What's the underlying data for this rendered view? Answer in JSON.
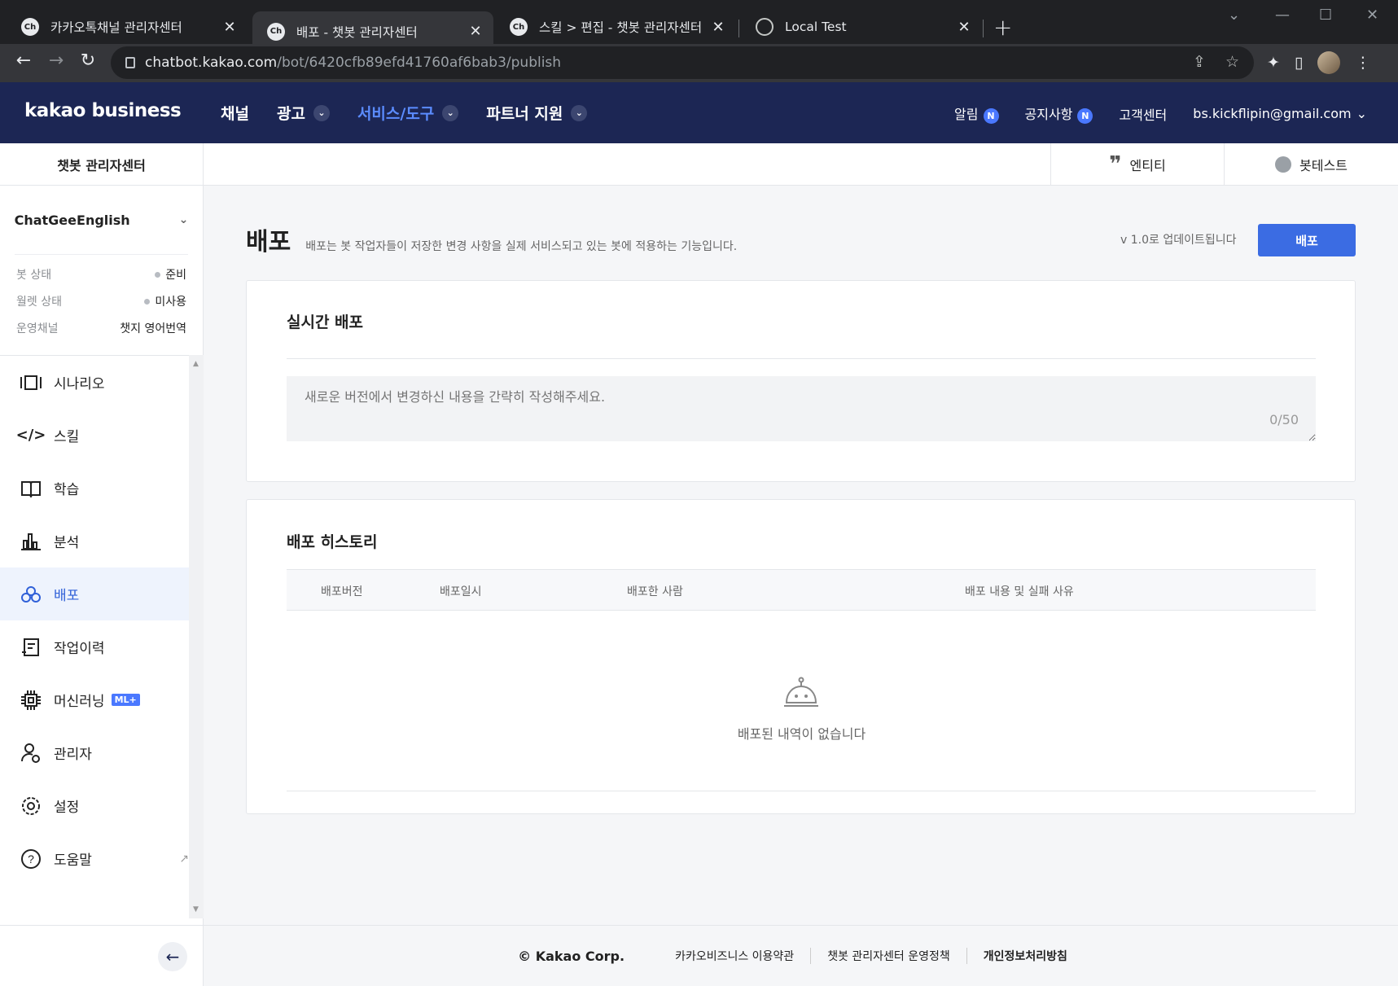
{
  "browser": {
    "tabs": [
      {
        "favicon": "Ch",
        "label": "카카오톡채널 관리자센터"
      },
      {
        "favicon": "Ch",
        "label": "배포 - 챗봇 관리자센터"
      },
      {
        "favicon": "Ch",
        "label": "스킬 > 편집 - 챗봇 관리자센터"
      },
      {
        "favicon": "globe-icon",
        "label": "Local Test"
      }
    ],
    "url_host": "chatbot.kakao.com",
    "url_path": "/bot/6420cfb89efd41760af6bab3/publish"
  },
  "header": {
    "logo": "kakao business",
    "nav": [
      {
        "label": "채널"
      },
      {
        "label": "광고"
      },
      {
        "label": "서비스/도구"
      },
      {
        "label": "파트너 지원"
      }
    ],
    "right": {
      "alert": "알림",
      "notice": "공지사항",
      "badge": "N",
      "support": "고객센터",
      "account": "bs.kickflipin@gmail.com"
    }
  },
  "sidebar": {
    "title": "챗봇 관리자센터",
    "bot_name": "ChatGeeEnglish",
    "info": [
      {
        "key": "봇 상태",
        "value": "준비"
      },
      {
        "key": "월렛 상태",
        "value": "미사용"
      },
      {
        "key": "운영채널",
        "value": "챗지 영어번역"
      }
    ],
    "menu": [
      {
        "label": "시나리오"
      },
      {
        "label": "스킬"
      },
      {
        "label": "학습"
      },
      {
        "label": "분석"
      },
      {
        "label": "배포"
      },
      {
        "label": "작업이력"
      },
      {
        "label": "머신러닝",
        "badge": "ML+"
      },
      {
        "label": "관리자"
      },
      {
        "label": "설정"
      },
      {
        "label": "도움말"
      }
    ]
  },
  "subbar": {
    "entity": "엔티티",
    "bottest": "봇테스트"
  },
  "page": {
    "title": "배포",
    "description": "배포는 봇 작업자들이 저장한 변경 사항을 실제 서비스되고 있는 봇에 적용하는 기능입니다.",
    "version_note": "v 1.0로 업데이트됩니다",
    "deploy_button": "배포",
    "live_title": "실시간 배포",
    "textarea_placeholder": "새로운 버전에서 변경하신 내용을 간략히 작성해주세요.",
    "counter": "0/50",
    "history_title": "배포 히스토리",
    "columns": [
      "배포버전",
      "배포일시",
      "배포한 사람",
      "배포 내용 및 실패 사유"
    ],
    "empty_text": "배포된 내역이 없습니다"
  },
  "footer": {
    "copyright": "© Kakao Corp.",
    "links": [
      "카카오비즈니스 이용약관",
      "챗봇 관리자센터 운영정책",
      "개인정보처리방침"
    ]
  },
  "colors": {
    "header_bg": "#1c2654",
    "accent": "#3b6ce3",
    "active_nav": "#5b8cff"
  }
}
